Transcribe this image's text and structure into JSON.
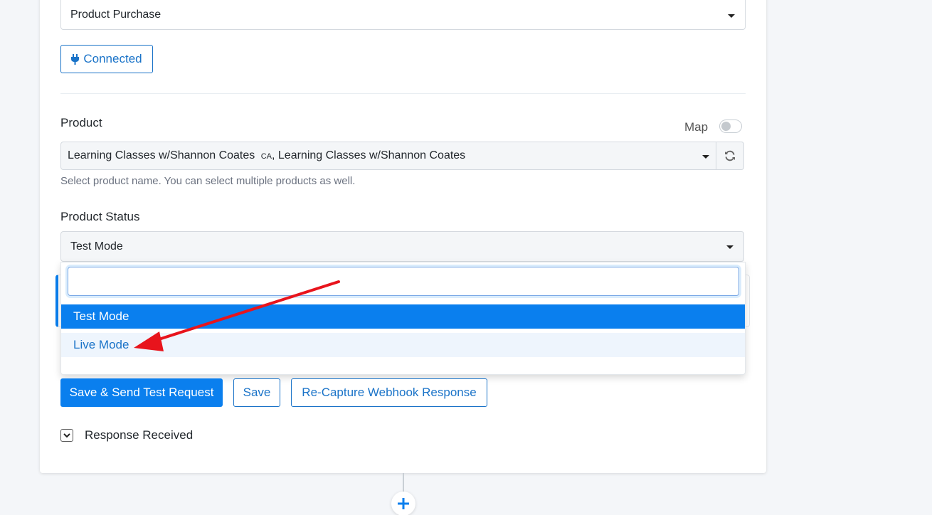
{
  "trigger": {
    "event_select": {
      "value": "Product Purchase"
    },
    "connected_button": {
      "label": "Connected",
      "icon": "plug-icon"
    }
  },
  "product": {
    "label": "Product",
    "map_label": "Map",
    "map_toggle_on": false,
    "select_value": "Learning Classes w/Shannon Coates",
    "select_value_tag": "CA",
    "select_value_rest": ", Learning Classes w/Shannon Coates",
    "help_text": "Select product name. You can select multiple products as well.",
    "refresh_icon": "refresh-icon"
  },
  "product_status": {
    "label": "Product Status",
    "select_value": "Test Mode",
    "dropdown": {
      "search_value": "",
      "options": [
        "Test Mode",
        "Live Mode"
      ],
      "selected_index": 0,
      "hovered_index": 1
    }
  },
  "actions": {
    "save_send_label": "Save & Send Test Request",
    "save_label": "Save",
    "recapture_label": "Re-Capture Webhook Response"
  },
  "response": {
    "label": "Response Received",
    "icon": "chevron-down-icon"
  },
  "add_step": {
    "icon": "plus-icon"
  },
  "annotation": {
    "arrow_color": "#e8141c"
  },
  "colors": {
    "accent": "#0a7fee",
    "link": "#1a73c8"
  }
}
